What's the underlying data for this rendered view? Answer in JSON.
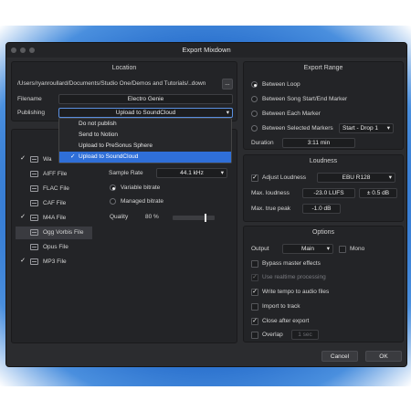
{
  "window": {
    "title": "Export Mixdown"
  },
  "location": {
    "title": "Location",
    "path": "/Users/ryanroullard/Documents/Studio One/Demos and Tutorials/..down",
    "browse_label": "...",
    "filename_label": "Filename",
    "filename_value": "Electro Genie",
    "publishing_label": "Publishing",
    "publishing_value": "Upload to SoundCloud",
    "publishing_options": [
      "Do not publish",
      "Send to Notion",
      "Upload to PreSonus Sphere",
      "Upload to SoundCloud"
    ]
  },
  "formats": {
    "items": [
      {
        "label": "Wa",
        "checked": true
      },
      {
        "label": "AIFF File",
        "checked": false
      },
      {
        "label": "FLAC File",
        "checked": false
      },
      {
        "label": "CAF File",
        "checked": false
      },
      {
        "label": "M4A File",
        "checked": true
      },
      {
        "label": "Ogg Vorbis File",
        "checked": false
      },
      {
        "label": "Opus File",
        "checked": false
      },
      {
        "label": "MP3 File",
        "checked": true
      }
    ],
    "sample_rate_label": "Sample Rate",
    "sample_rate_value": "44.1 kHz",
    "variable_bitrate_label": "Variable bitrate",
    "managed_bitrate_label": "Managed bitrate",
    "quality_label": "Quality",
    "quality_value": "80 %",
    "quality_fraction": 0.8
  },
  "export_range": {
    "title": "Export Range",
    "options": [
      "Between Loop",
      "Between Song Start/End Marker",
      "Between Each Marker",
      "Between Selected Markers"
    ],
    "selected_marker": "Start - Drop 1",
    "duration_label": "Duration",
    "duration_value": "3:11 min"
  },
  "loudness": {
    "title": "Loudness",
    "adjust_label": "Adjust Loudness",
    "standard": "EBU R128",
    "max_loudness_label": "Max. loudness",
    "max_loudness_value": "-23.0 LUFS",
    "tolerance_value": "± 0.5 dB",
    "max_true_peak_label": "Max. true peak",
    "max_true_peak_value": "-1.0 dB"
  },
  "options": {
    "title": "Options",
    "output_label": "Output",
    "output_value": "Main",
    "mono_label": "Mono",
    "bypass_label": "Bypass master effects",
    "realtime_label": "Use realtime processing",
    "write_tempo_label": "Write tempo to audio files",
    "import_label": "Import to track",
    "close_label": "Close after export",
    "overlap_label": "Overlap",
    "overlap_value": "1 sec"
  },
  "footer": {
    "cancel_label": "Cancel",
    "ok_label": "OK"
  },
  "icons": {
    "check": "✓",
    "chevron": "▾"
  },
  "colors": {
    "accent": "#2f6fd8",
    "backdrop": "#1f66c8"
  }
}
